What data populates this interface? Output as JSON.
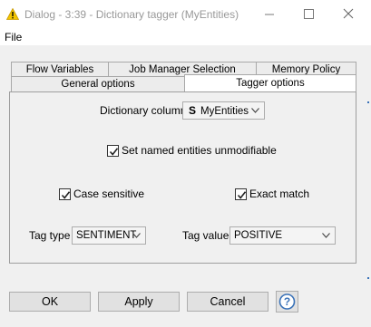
{
  "window": {
    "title": "Dialog - 3:39 - Dictionary tagger (MyEntities)",
    "icon": "warning-triangle-icon",
    "controls": [
      "minimize-icon",
      "maximize-icon",
      "close-icon"
    ]
  },
  "menubar": {
    "file_label": "File"
  },
  "tabs": {
    "back_row": [
      "Flow Variables",
      "Job Manager Selection",
      "Memory Policy"
    ],
    "front_row": [
      "General options",
      "Tagger options"
    ],
    "active": "Tagger options"
  },
  "form": {
    "dictionary_column_label": "Dictionary column",
    "dictionary_column_type_icon": "S",
    "dictionary_column_value": "MyEntities",
    "set_unmodifiable_label": "Set named entities unmodifiable",
    "set_unmodifiable_checked": true,
    "case_sensitive_label": "Case sensitive",
    "case_sensitive_checked": true,
    "exact_match_label": "Exact match",
    "exact_match_checked": true,
    "tag_type_label": "Tag type",
    "tag_type_value": "SENTIMENT",
    "tag_value_label": "Tag value",
    "tag_value_value": "POSITIVE"
  },
  "buttons": {
    "ok": "OK",
    "apply": "Apply",
    "cancel": "Cancel",
    "help_icon": "help-question-icon"
  },
  "colors": {
    "accent": "#3a72b8",
    "warning": "#f2c500"
  }
}
